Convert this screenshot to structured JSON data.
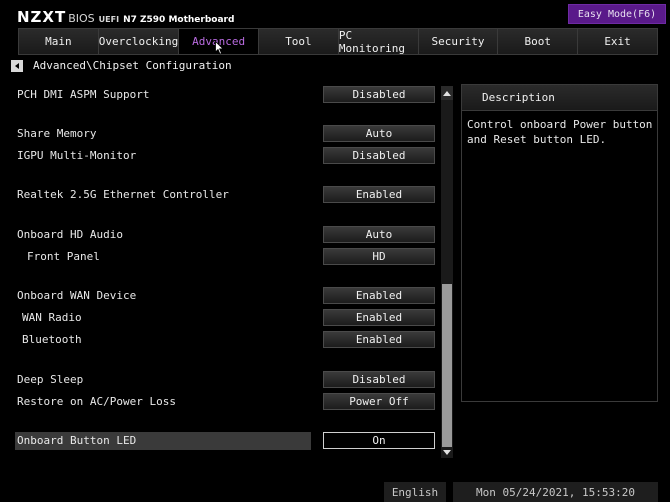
{
  "header": {
    "logo": "NZXT",
    "bios": "BIOS",
    "uefi": "UEFI",
    "board": "N7 Z590 Motherboard",
    "easy_mode": "Easy Mode(F6)"
  },
  "tabs": [
    {
      "label": "Main"
    },
    {
      "label": "Overclocking"
    },
    {
      "label": "Advanced",
      "active": true
    },
    {
      "label": "Tool"
    },
    {
      "label": "PC Monitoring"
    },
    {
      "label": "Security"
    },
    {
      "label": "Boot"
    },
    {
      "label": "Exit"
    }
  ],
  "breadcrumb": "Advanced\\Chipset Configuration",
  "settings": [
    {
      "label": "PCH DMI ASPM Support",
      "value": "Disabled"
    },
    {
      "label": "Share Memory",
      "value": "Auto"
    },
    {
      "label": "IGPU Multi-Monitor",
      "value": "Disabled"
    },
    {
      "label": "Realtek 2.5G Ethernet Controller",
      "value": "Enabled"
    },
    {
      "label": "Onboard HD Audio",
      "value": "Auto"
    },
    {
      "label": "Front Panel",
      "value": "HD"
    },
    {
      "label": "Onboard WAN Device",
      "value": "Enabled"
    },
    {
      "label": "WAN Radio",
      "value": "Enabled"
    },
    {
      "label": "Bluetooth",
      "value": "Enabled"
    },
    {
      "label": "Deep Sleep",
      "value": "Disabled"
    },
    {
      "label": "Restore on AC/Power Loss",
      "value": "Power Off"
    },
    {
      "label": "Onboard Button LED",
      "value": "On",
      "selected": true
    }
  ],
  "description": {
    "title": "Description",
    "text": "Control onboard Power button and Reset button LED."
  },
  "footer": {
    "language": "English",
    "datetime": "Mon 05/24/2021, 15:53:20"
  },
  "colors": {
    "accent": "#b96be0",
    "easy_mode_bg": "#5a1a8a"
  }
}
